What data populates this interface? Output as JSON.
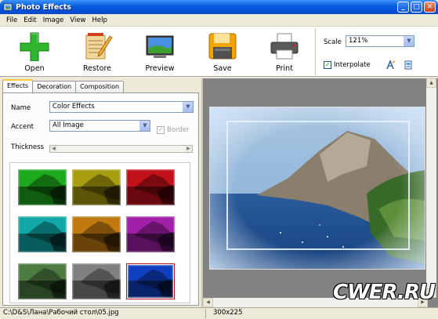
{
  "window": {
    "title": "Photo Effects",
    "buttons": [
      "_",
      "□",
      "✕"
    ]
  },
  "menu": [
    "File",
    "Edit",
    "Image",
    "View",
    "Help"
  ],
  "toolbar": {
    "open": "Open",
    "restore": "Restore",
    "preview": "Preview",
    "save": "Save",
    "print": "Print",
    "scale_label": "Scale",
    "scale_value": "121%",
    "interpolate_label": "Interpolate",
    "interpolate_checked": true
  },
  "tabs": [
    "Effects",
    "Decoration",
    "Composition"
  ],
  "effects": {
    "name_label": "Name",
    "name_value": "Color Effects",
    "accent_label": "Accent",
    "accent_value": "All Image",
    "border_label": "Border",
    "border_checked": true,
    "thickness_label": "Thickness"
  },
  "thumbnails": [
    {
      "color": "#1ea81e",
      "selected": false
    },
    {
      "color": "#a89c10",
      "selected": false
    },
    {
      "color": "#c0101a",
      "selected": false
    },
    {
      "color": "#10a8a8",
      "selected": false
    },
    {
      "color": "#c07a10",
      "selected": false
    },
    {
      "color": "#a020a8",
      "selected": false
    },
    {
      "color": "#4c7c42",
      "selected": false
    },
    {
      "color": "#808080",
      "selected": false
    },
    {
      "color": "#1040c0",
      "selected": true
    }
  ],
  "status": {
    "path": "C:\\D&S\\Лана\\Рабочий стол\\05.jpg",
    "size": "300x225"
  },
  "watermark": "CWER.RU"
}
